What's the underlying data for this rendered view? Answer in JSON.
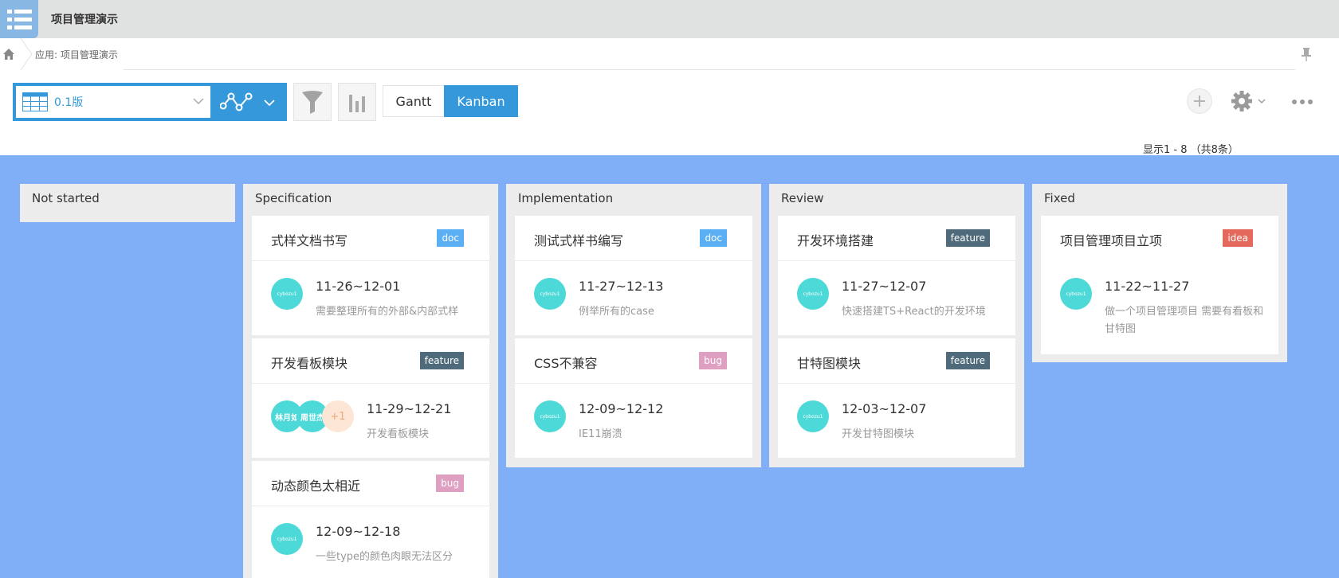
{
  "app": {
    "title": "项目管理演示"
  },
  "breadcrumb": {
    "text": "应用: 项目管理演示"
  },
  "toolbar": {
    "view_label": "0.1版",
    "gantt_label": "Gantt",
    "kanban_label": "Kanban",
    "count_text": "显示1 - 8 （共8条）"
  },
  "colors": {
    "accent": "#3498db",
    "board_bg": "#80aff7",
    "avatar": "#4dd9d7",
    "tag_doc": "#5bb0f5",
    "tag_feature": "#4f6b7b",
    "tag_bug": "#df9fc0",
    "tag_idea": "#e5685c"
  },
  "columns": [
    {
      "title": "Not started",
      "cards": []
    },
    {
      "title": "Specification",
      "cards": [
        {
          "title": "式样文档书写",
          "tag": "doc",
          "avatars": [
            "cybozu1"
          ],
          "date": "11-26~12-01",
          "desc": "需要整理所有的外部&内部式样"
        },
        {
          "title": "开发看板模块",
          "tag": "feature",
          "avatars": [
            "林月如",
            "周世杰"
          ],
          "more": "+1",
          "date": "11-29~12-21",
          "desc": "开发看板模块"
        },
        {
          "title": "动态颜色太相近",
          "tag": "bug",
          "avatars": [
            "cybozu1"
          ],
          "date": "12-09~12-18",
          "desc": "一些type的颜色肉眼无法区分"
        }
      ]
    },
    {
      "title": "Implementation",
      "cards": [
        {
          "title": "测试式样书编写",
          "tag": "doc",
          "avatars": [
            "cybozu1"
          ],
          "date": "11-27~12-13",
          "desc": "例举所有的case"
        },
        {
          "title": "CSS不兼容",
          "tag": "bug",
          "avatars": [
            "cybozu1"
          ],
          "date": "12-09~12-12",
          "desc": "IE11崩溃"
        }
      ]
    },
    {
      "title": "Review",
      "cards": [
        {
          "title": "开发环境搭建",
          "tag": "feature",
          "avatars": [
            "cybozu1"
          ],
          "date": "11-27~12-07",
          "desc": "快速搭建TS+React的开发环境"
        },
        {
          "title": "甘特图模块",
          "tag": "feature",
          "avatars": [
            "cybozu1"
          ],
          "date": "12-03~12-07",
          "desc": "开发甘特图模块"
        }
      ]
    },
    {
      "title": "Fixed",
      "cards": [
        {
          "title": "项目管理项目立项",
          "tag": "idea",
          "avatars": [
            "cybozu1"
          ],
          "date": "11-22~11-27",
          "desc": "做一个项目管理项目 需要有看板和甘特图"
        }
      ]
    }
  ]
}
